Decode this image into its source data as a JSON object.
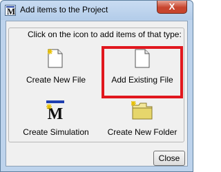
{
  "window": {
    "title": "Add items to the Project",
    "close_glyph": "X",
    "app_icon": "m-logo-icon"
  },
  "group": {
    "legend": "Click on the icon to add items of that type:"
  },
  "items": [
    {
      "label": "Create New File",
      "icon": "new-file-icon"
    },
    {
      "label": "Add Existing File",
      "icon": "existing-file-icon",
      "highlighted": true
    },
    {
      "label": "Create Simulation",
      "icon": "simulation-icon"
    },
    {
      "label": "Create New Folder",
      "icon": "new-folder-icon"
    }
  ],
  "footer": {
    "close_label": "Close"
  },
  "colors": {
    "highlight": "#e1171e",
    "title_bar": "#bdd3ec",
    "close_button": "#c7452e"
  }
}
